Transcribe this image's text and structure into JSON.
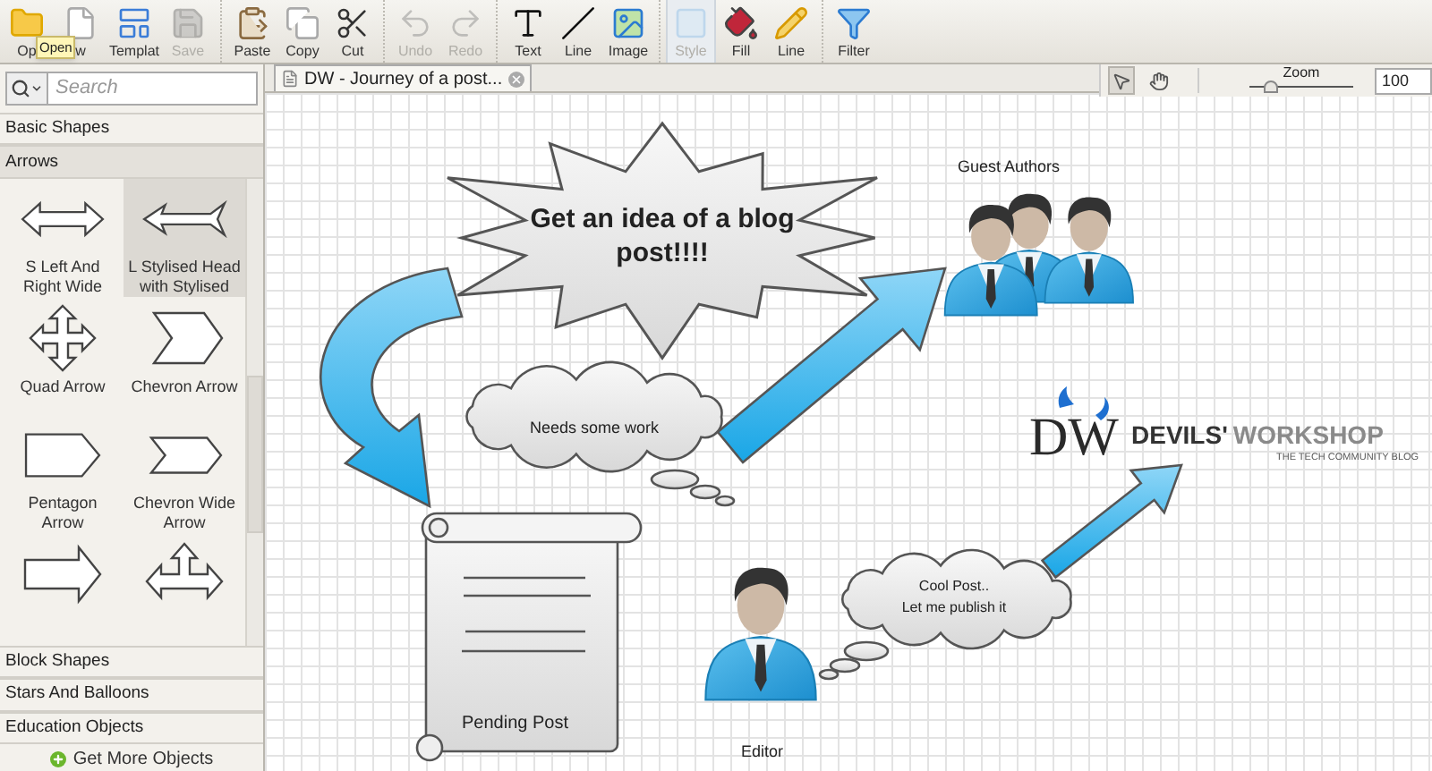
{
  "toolbar": {
    "groups": [
      [
        {
          "label": "Op",
          "disabled": false,
          "selected": false
        },
        {
          "label": "w",
          "disabled": false,
          "selected": false
        },
        {
          "label": "Templat",
          "disabled": false,
          "selected": false
        },
        {
          "label": "Save",
          "disabled": true,
          "selected": false
        }
      ],
      [
        {
          "label": "Paste",
          "disabled": false,
          "selected": false
        },
        {
          "label": "Copy",
          "disabled": false,
          "selected": false
        },
        {
          "label": "Cut",
          "disabled": false,
          "selected": false
        }
      ],
      [
        {
          "label": "Undo",
          "disabled": true,
          "selected": false
        },
        {
          "label": "Redo",
          "disabled": true,
          "selected": false
        }
      ],
      [
        {
          "label": "Text",
          "disabled": false,
          "selected": false
        },
        {
          "label": "Line",
          "disabled": false,
          "selected": false
        },
        {
          "label": "Image",
          "disabled": false,
          "selected": false
        }
      ],
      [
        {
          "label": "Style",
          "disabled": true,
          "selected": true
        },
        {
          "label": "Fill",
          "disabled": false,
          "selected": false
        },
        {
          "label": "Line",
          "disabled": false,
          "selected": false
        }
      ],
      [
        {
          "label": "Filter",
          "disabled": false,
          "selected": false
        }
      ]
    ],
    "tooltip": "Open"
  },
  "sidebar": {
    "search": {
      "placeholder": "Search"
    },
    "sections": [
      {
        "title": "Basic Shapes",
        "expanded": false
      },
      {
        "title": "Arrows",
        "expanded": true,
        "shapes": [
          {
            "label": "S Left And Right Wide",
            "selected": false
          },
          {
            "label": "L Stylised Head with Stylised",
            "selected": true
          },
          {
            "label": "Quad Arrow",
            "selected": false
          },
          {
            "label": "Chevron Arrow",
            "selected": false
          },
          {
            "label": "Pentagon Arrow",
            "selected": false
          },
          {
            "label": "Chevron Wide Arrow",
            "selected": false
          },
          {
            "selected": false
          },
          {
            "selected": false
          }
        ]
      },
      {
        "title": "Block Shapes",
        "expanded": false
      },
      {
        "title": "Stars And Balloons",
        "expanded": false
      },
      {
        "title": "Education Objects",
        "expanded": false
      }
    ],
    "get_more": "Get More Objects"
  },
  "document_tab": {
    "title": "DW - Journey of a post...",
    "selected": true
  },
  "canvas_tools": [
    {
      "selected": true
    },
    {
      "selected": false
    }
  ],
  "zoom": {
    "label": "Zoom",
    "level": 0.2,
    "value": "100"
  },
  "diagram": {
    "burst": "Get an idea of a blog post!!!!",
    "thought": "Needs some work",
    "group_label": "Guest Authors",
    "logo": {
      "mark": "DW",
      "name_first": "DEVILS'",
      "name_second": "WORKSHOP",
      "tagline": "THE TECH COMMUNITY BLOG"
    },
    "document_label": "Pending Post",
    "person_label": "Editor",
    "reply_lines": [
      "Cool Post..",
      "Let me publish it"
    ]
  }
}
